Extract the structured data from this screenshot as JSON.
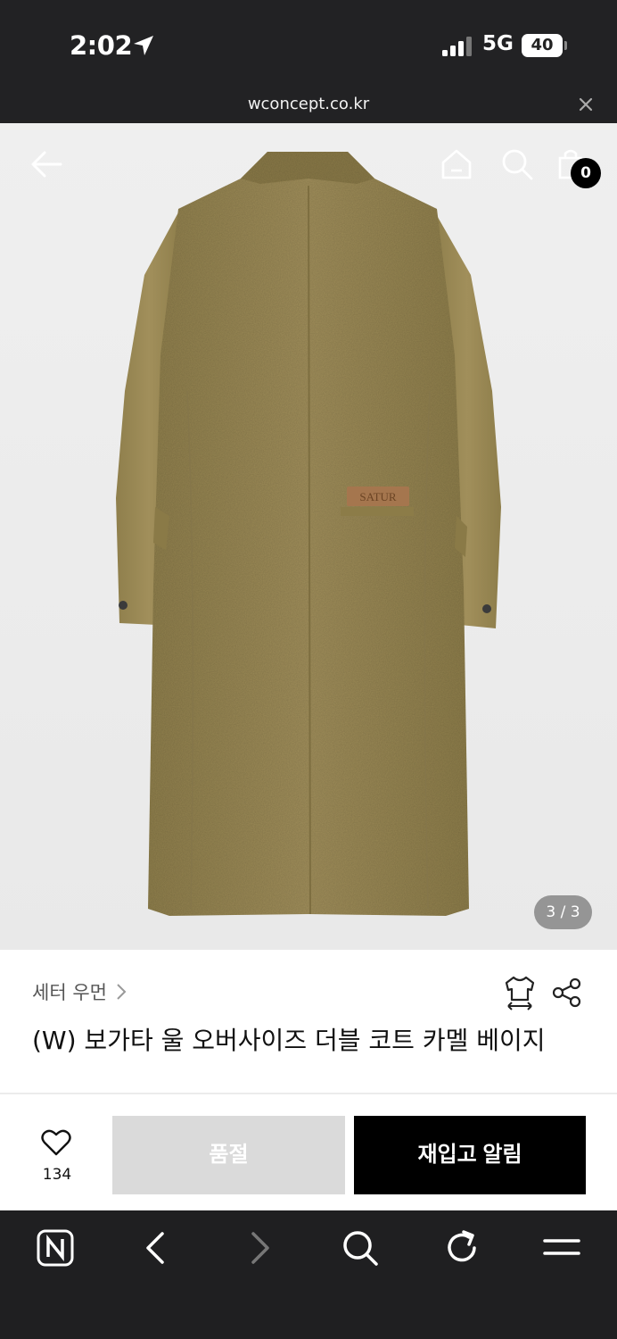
{
  "status": {
    "time": "2:02",
    "network": "5G",
    "battery": "40"
  },
  "browser": {
    "url": "wconcept.co.kr"
  },
  "header": {
    "cart_count": "0"
  },
  "gallery": {
    "counter": "3 / 3",
    "label_text": "SATUR"
  },
  "product": {
    "brand": "세터 우먼",
    "title": "(W) 보가타 울 오버사이즈 더블 코트 카멜 베이지"
  },
  "actions": {
    "like_count": "134",
    "soldout_label": "품절",
    "restock_label": "재입고 알림"
  },
  "colors": {
    "coat": "#9b8a55",
    "accent": "#000000",
    "disabled": "#dadada"
  },
  "icons": [
    "location-arrow-icon",
    "signal-icon",
    "battery-icon",
    "close-icon",
    "back-arrow-icon",
    "home-icon",
    "search-icon",
    "cart-icon",
    "chevron-right-icon",
    "size-fit-icon",
    "share-icon",
    "heart-icon",
    "naver-icon",
    "browser-back-icon",
    "browser-forward-icon",
    "browser-search-icon",
    "refresh-icon",
    "menu-icon"
  ]
}
